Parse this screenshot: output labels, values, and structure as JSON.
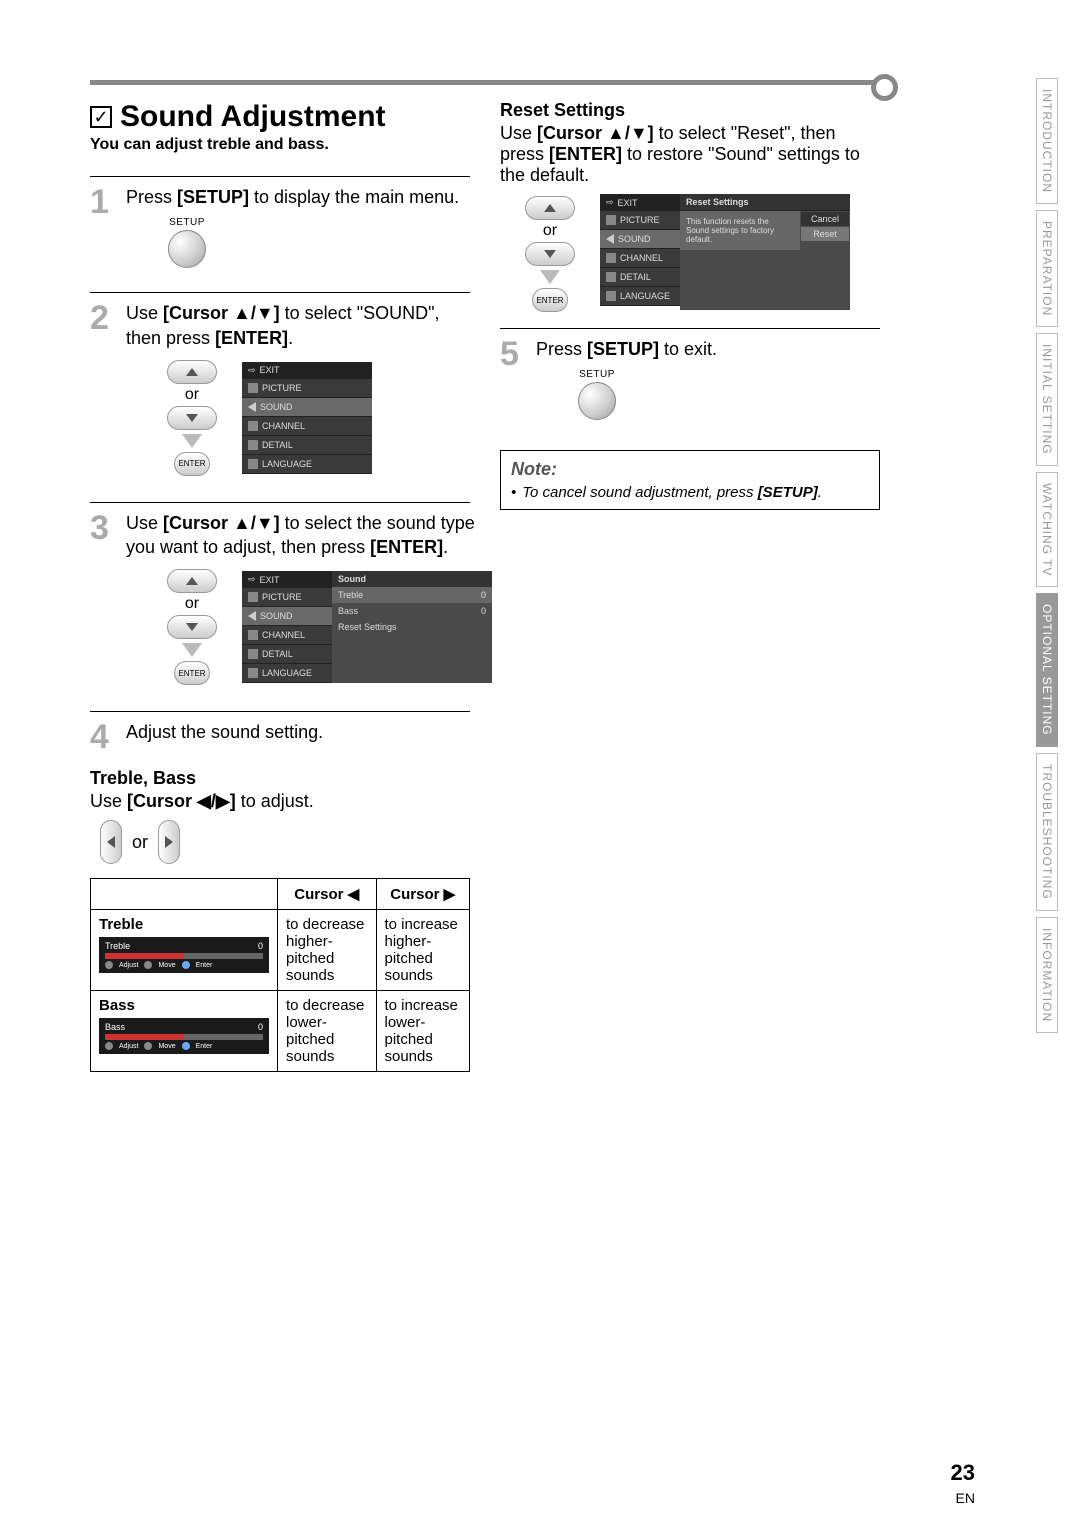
{
  "title": "Sound Adjustment",
  "subtitle": "You can adjust treble and bass.",
  "steps": {
    "s1": {
      "num": "1",
      "text_a": "Press ",
      "text_b": " to display the main menu.",
      "key": "[SETUP]"
    },
    "s2": {
      "num": "2",
      "text_a": "Use ",
      "key1": "[Cursor ▲/▼]",
      "text_b": " to select \"SOUND\", then press ",
      "key2": "[ENTER]",
      "text_c": "."
    },
    "s3": {
      "num": "3",
      "text_a": "Use ",
      "key1": "[Cursor ▲/▼]",
      "text_b": " to select the sound type you want to adjust, then press ",
      "key2": "[ENTER]",
      "text_c": "."
    },
    "s4": {
      "num": "4",
      "text": "Adjust the sound setting."
    },
    "s5": {
      "num": "5",
      "text_a": "Press ",
      "key": "[SETUP]",
      "text_b": " to exit."
    }
  },
  "setup_label": "SETUP",
  "or_label": "or",
  "enter_label": "ENTER",
  "menu": {
    "exit": "EXIT",
    "picture": "PICTURE",
    "sound": "SOUND",
    "channel": "CHANNEL",
    "detail": "DETAIL",
    "language": "LANGUAGE"
  },
  "sound_panel": {
    "title": "Sound",
    "treble": "Treble",
    "bass": "Bass",
    "reset": "Reset Settings",
    "val": "0"
  },
  "treble_bass": {
    "heading": "Treble, Bass",
    "instr_a": "Use ",
    "instr_key": "[Cursor ◀/▶]",
    "instr_b": " to adjust."
  },
  "table": {
    "col_left": "Cursor ◀",
    "col_right": "Cursor ▶",
    "row1_label": "Treble",
    "row1_left": "to decrease higher-pitched sounds",
    "row1_right": "to increase higher-pitched sounds",
    "row2_label": "Bass",
    "row2_left": "to decrease lower-pitched sounds",
    "row2_right": "to increase lower-pitched sounds",
    "slider_treble": "Treble",
    "slider_bass": "Bass",
    "slider_val": "0",
    "adjust": "Adjust",
    "move": "Move",
    "enter": "Enter"
  },
  "reset": {
    "heading": "Reset Settings",
    "instr_a": "Use ",
    "instr_key1": "[Cursor ▲/▼]",
    "instr_b": " to select \"Reset\", then press ",
    "instr_key2": "[ENTER]",
    "instr_c": " to restore \"Sound\" settings to the default.",
    "panel_title": "Reset Settings",
    "panel_msg": "This function resets the Sound settings to factory default.",
    "cancel": "Cancel",
    "reset_btn": "Reset"
  },
  "note": {
    "title": "Note:",
    "item_a": "To cancel sound adjustment, press ",
    "item_key": "[SETUP]",
    "item_b": "."
  },
  "sidetabs": {
    "introduction": "INTRODUCTION",
    "preparation": "PREPARATION",
    "initial": "INITIAL SETTING",
    "watching": "WATCHING TV",
    "optional": "OPTIONAL SETTING",
    "troubleshooting": "TROUBLESHOOTING",
    "information": "INFORMATION"
  },
  "page_number": "23",
  "lang_code": "EN"
}
